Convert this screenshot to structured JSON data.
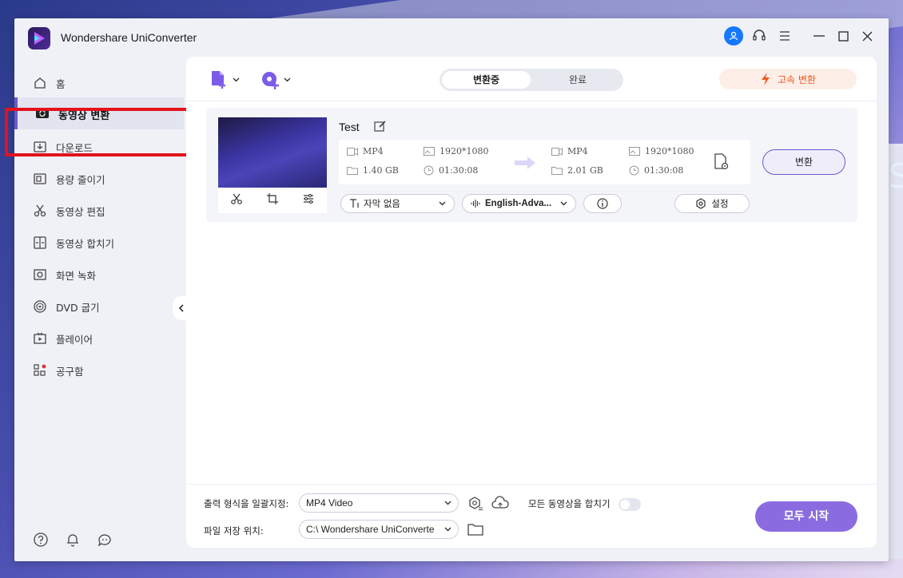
{
  "app": {
    "title": "Wondershare UniConverter"
  },
  "sidebar": {
    "items": [
      {
        "label": "홈",
        "icon": "home-icon"
      },
      {
        "label": "동영상 변환",
        "icon": "convert-icon",
        "active": true
      },
      {
        "label": "다운로드",
        "icon": "download-icon"
      },
      {
        "label": "용량 줄이기",
        "icon": "compress-icon"
      },
      {
        "label": "동영상 편집",
        "icon": "scissors-icon"
      },
      {
        "label": "동영상 합치기",
        "icon": "merge-icon"
      },
      {
        "label": "화면 녹화",
        "icon": "screen-record-icon"
      },
      {
        "label": "DVD 굽기",
        "icon": "dvd-icon"
      },
      {
        "label": "플레이어",
        "icon": "player-icon"
      },
      {
        "label": "공구함",
        "icon": "toolbox-icon"
      }
    ]
  },
  "tabs": {
    "converting": "변환중",
    "done": "완료"
  },
  "fast_convert": "고속 변환",
  "file": {
    "name": "Test",
    "source": {
      "format": "MP4",
      "resolution": "1920*1080",
      "size": "1.40 GB",
      "duration": "01:30:08"
    },
    "target": {
      "format": "MP4",
      "resolution": "1920*1080",
      "size": "2.01 GB",
      "duration": "01:30:08"
    },
    "convert_label": "변환",
    "subtitle": "자막 없음",
    "audio": "English-Adva...",
    "settings_label": "설정"
  },
  "footer": {
    "format_label": "출력 형식을 일괄지정:",
    "format_value": "MP4 Video",
    "location_label": "파일 저장 위치:",
    "location_value": "C:\\ Wondershare UniConverte",
    "merge_label": "모든 동영상을 합치기",
    "start_label": "모두 시작"
  },
  "colors": {
    "accent": "#6a5acd",
    "start": "#8b6ce0",
    "fast": "#e85a1f",
    "highlight": "#e3121b"
  }
}
